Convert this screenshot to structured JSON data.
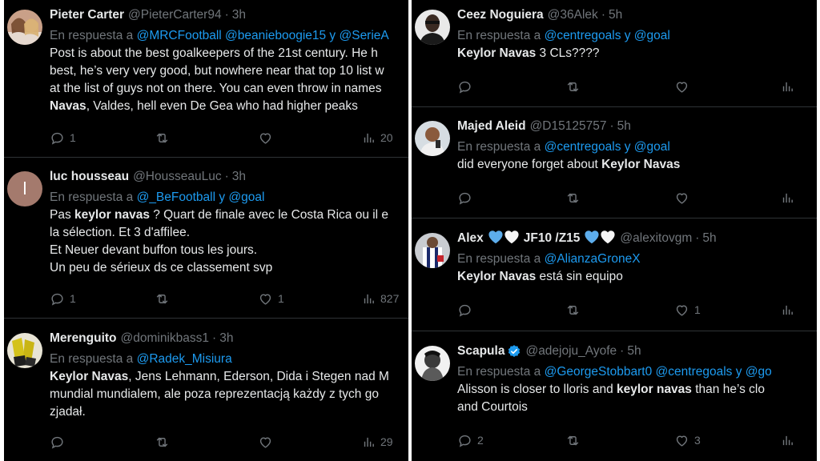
{
  "left_column": {
    "tweets": [
      {
        "name": "Pieter Carter",
        "handle": "@PieterCarter94",
        "time": "3h",
        "reply_prefix": "En respuesta a ",
        "reply_mentions": "@MRCFootball @beanieboogie15 y @SerieA",
        "lines": [
          [
            {
              "t": "Post is about the best goalkeepers of the 21st century. He h"
            }
          ],
          [
            {
              "t": "best, he’s very very good, but nowhere near that top 10 list w"
            }
          ],
          [
            {
              "t": "at the list of guys not on there. You can even throw in names"
            }
          ],
          [
            {
              "t": "Navas",
              "b": true
            },
            {
              "t": ", Valdes, hell even De Gea who had higher peaks"
            }
          ]
        ],
        "stats": {
          "replies": "1",
          "retweets": "",
          "likes": "",
          "views": "20"
        }
      },
      {
        "name": "luc housseau",
        "handle": "@HousseauLuc",
        "time": "3h",
        "avatar_letter": "l",
        "reply_prefix": "En respuesta a ",
        "reply_mentions": "@_BeFootball y @goal",
        "lines": [
          [
            {
              "t": "Pas "
            },
            {
              "t": "keylor navas",
              "b": true
            },
            {
              "t": " ? Quart de finale avec le Costa Rica ou il e"
            }
          ],
          [
            {
              "t": "la sélection. Et 3 d'affilee."
            }
          ],
          [
            {
              "t": "Et Neuer devant buffon tous les jours."
            }
          ],
          [
            {
              "t": "Un peu de sérieux ds ce classement svp"
            }
          ]
        ],
        "stats": {
          "replies": "1",
          "retweets": "",
          "likes": "1",
          "views": "827"
        }
      },
      {
        "name": "Merenguito",
        "handle": "@dominikbass1",
        "time": "3h",
        "reply_prefix": "En respuesta a ",
        "reply_mentions": "@Radek_Misiura",
        "lines": [
          [
            {
              "t": "Keylor Navas",
              "b": true
            },
            {
              "t": ", Jens Lehmann, Ederson, Dida i Stegen nad M"
            }
          ],
          [
            {
              "t": "mundial mundialem, ale poza reprezentacją każdy z tych go"
            }
          ],
          [
            {
              "t": "zjadał."
            }
          ]
        ],
        "stats": {
          "replies": "",
          "retweets": "",
          "likes": "",
          "views": "29"
        }
      }
    ]
  },
  "right_column": {
    "tweets": [
      {
        "name": "Ceez Noguiera",
        "handle": "@36Alek",
        "time": "5h",
        "reply_prefix": "En respuesta a ",
        "reply_mentions": "@centregoals y @goal",
        "lines": [
          [
            {
              "t": "Keylor Navas",
              "b": true
            },
            {
              "t": " 3 CLs????"
            }
          ]
        ],
        "stats": {
          "replies": "",
          "retweets": "",
          "likes": "",
          "views": ""
        }
      },
      {
        "name": "Majed Aleid",
        "handle": "@D15125757",
        "time": "5h",
        "reply_prefix": "En respuesta a ",
        "reply_mentions": "@centregoals y @goal",
        "lines": [
          [
            {
              "t": "did everyone forget about "
            },
            {
              "t": "Keylor Navas",
              "b": true
            }
          ]
        ],
        "stats": {
          "replies": "",
          "retweets": "",
          "likes": "",
          "views": ""
        }
      },
      {
        "name": "Alex",
        "name_suffix": "JF10 /Z15",
        "handle": "@alexitovgm",
        "time": "5h",
        "reply_prefix": "En respuesta a ",
        "reply_mentions": "@AlianzaGroneX",
        "lines": [
          [
            {
              "t": "Keylor Navas",
              "b": true
            },
            {
              "t": " está sin equipo"
            }
          ]
        ],
        "stats": {
          "replies": "",
          "retweets": "",
          "likes": "1",
          "views": ""
        }
      },
      {
        "name": "Scapula",
        "handle": "@adejoju_Ayofe",
        "time": "5h",
        "verified": true,
        "reply_prefix": "En respuesta a ",
        "reply_mentions": "@GeorgeStobbart0 @centregoals y @go",
        "lines": [
          [
            {
              "t": "Alisson is closer to lloris and "
            },
            {
              "t": "keylor navas",
              "b": true
            },
            {
              "t": " than he’s clo"
            }
          ],
          [
            {
              "t": "and Courtois"
            }
          ]
        ],
        "stats": {
          "replies": "2",
          "retweets": "",
          "likes": "3",
          "views": ""
        }
      }
    ]
  },
  "separator": "·",
  "colors": {
    "background": "#000000",
    "text": "#e7e9ea",
    "muted": "#71767b",
    "link": "#1d9bf0",
    "divider": "#2f3336",
    "verified": "#1d9bf0"
  },
  "icons": [
    "reply-icon",
    "retweet-icon",
    "like-icon",
    "views-icon",
    "verified-badge-icon",
    "blue-heart-icon",
    "white-heart-icon"
  ]
}
